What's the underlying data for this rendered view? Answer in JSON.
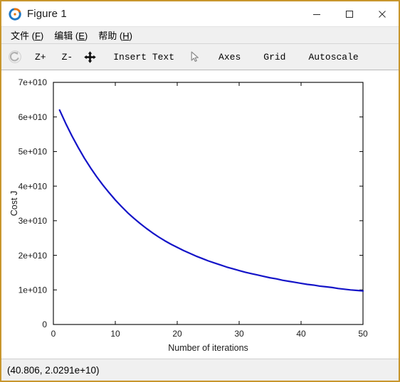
{
  "window": {
    "title": "Figure 1",
    "app_icon": "octave-logo-icon",
    "border_color": "#c8962d",
    "controls": {
      "minimize": "─",
      "maximize": "☐",
      "close": "✕"
    }
  },
  "menubar": {
    "items": [
      {
        "label": "文件",
        "mnemonic": "F"
      },
      {
        "label": "编辑",
        "mnemonic": "E"
      },
      {
        "label": "帮助",
        "mnemonic": "H"
      }
    ]
  },
  "toolbar": {
    "items": [
      {
        "kind": "icon",
        "name": "undo-rotate-icon",
        "label": ""
      },
      {
        "kind": "text",
        "name": "zoom-in-button",
        "label": "Z+"
      },
      {
        "kind": "text",
        "name": "zoom-out-button",
        "label": "Z-"
      },
      {
        "kind": "icon",
        "name": "pan-move-icon",
        "label": ""
      },
      {
        "kind": "text",
        "name": "insert-text-button",
        "label": "Insert Text"
      },
      {
        "kind": "icon",
        "name": "select-pointer-icon",
        "label": ""
      },
      {
        "kind": "text",
        "name": "axes-button",
        "label": "Axes"
      },
      {
        "kind": "text",
        "name": "grid-button",
        "label": "Grid"
      },
      {
        "kind": "text",
        "name": "autoscale-button",
        "label": "Autoscale"
      }
    ]
  },
  "statusbar": {
    "coordinates": "(40.806, 2.0291e+10)"
  },
  "chart_data": {
    "type": "line",
    "title": "",
    "xlabel": "Number of iterations",
    "ylabel": "Cost J",
    "xlim": [
      0,
      50
    ],
    "ylim": [
      0,
      70000000000
    ],
    "grid": false,
    "legend": null,
    "line_color": "#1414c8",
    "line_width": 2.2,
    "background": "#ffffff",
    "axis_color": "#000000",
    "xticks": [
      0,
      10,
      20,
      30,
      40,
      50
    ],
    "xticklabels": [
      "0",
      "10",
      "20",
      "30",
      "40",
      "50"
    ],
    "yticks": [
      0,
      10000000000,
      20000000000,
      30000000000,
      40000000000,
      50000000000,
      60000000000,
      70000000000
    ],
    "yticklabels": [
      "0",
      "1e+010",
      "2e+010",
      "3e+010",
      "4e+010",
      "5e+010",
      "6e+010",
      "7e+010"
    ],
    "series": [
      {
        "name": "Cost J",
        "x": [
          1,
          2,
          3,
          4,
          5,
          6,
          7,
          8,
          9,
          10,
          11,
          12,
          13,
          14,
          15,
          16,
          17,
          18,
          19,
          20,
          21,
          22,
          23,
          24,
          25,
          26,
          27,
          28,
          29,
          30,
          31,
          32,
          33,
          34,
          35,
          36,
          37,
          38,
          39,
          40,
          41,
          42,
          43,
          44,
          45,
          46,
          47,
          48,
          49,
          50
        ],
        "y": [
          62000000000,
          58100000000,
          54500000000,
          51200000000,
          48100000000,
          45300000000,
          42700000000,
          40300000000,
          38100000000,
          36000000000,
          34100000000,
          32300000000,
          30700000000,
          29200000000,
          27800000000,
          26500000000,
          25300000000,
          24200000000,
          23200000000,
          22300000000,
          21400000000,
          20600000000,
          19800000000,
          19100000000,
          18400000000,
          17800000000,
          17200000000,
          16600000000,
          16100000000,
          15600000000,
          15100000000,
          14700000000,
          14300000000,
          13900000000,
          13500000000,
          13200000000,
          12800000000,
          12500000000,
          12200000000,
          11900000000,
          11600000000,
          11400000000,
          11100000000,
          10900000000,
          10700000000,
          10400000000,
          10200000000,
          10000000000,
          9850000000,
          9700000000
        ]
      }
    ]
  }
}
